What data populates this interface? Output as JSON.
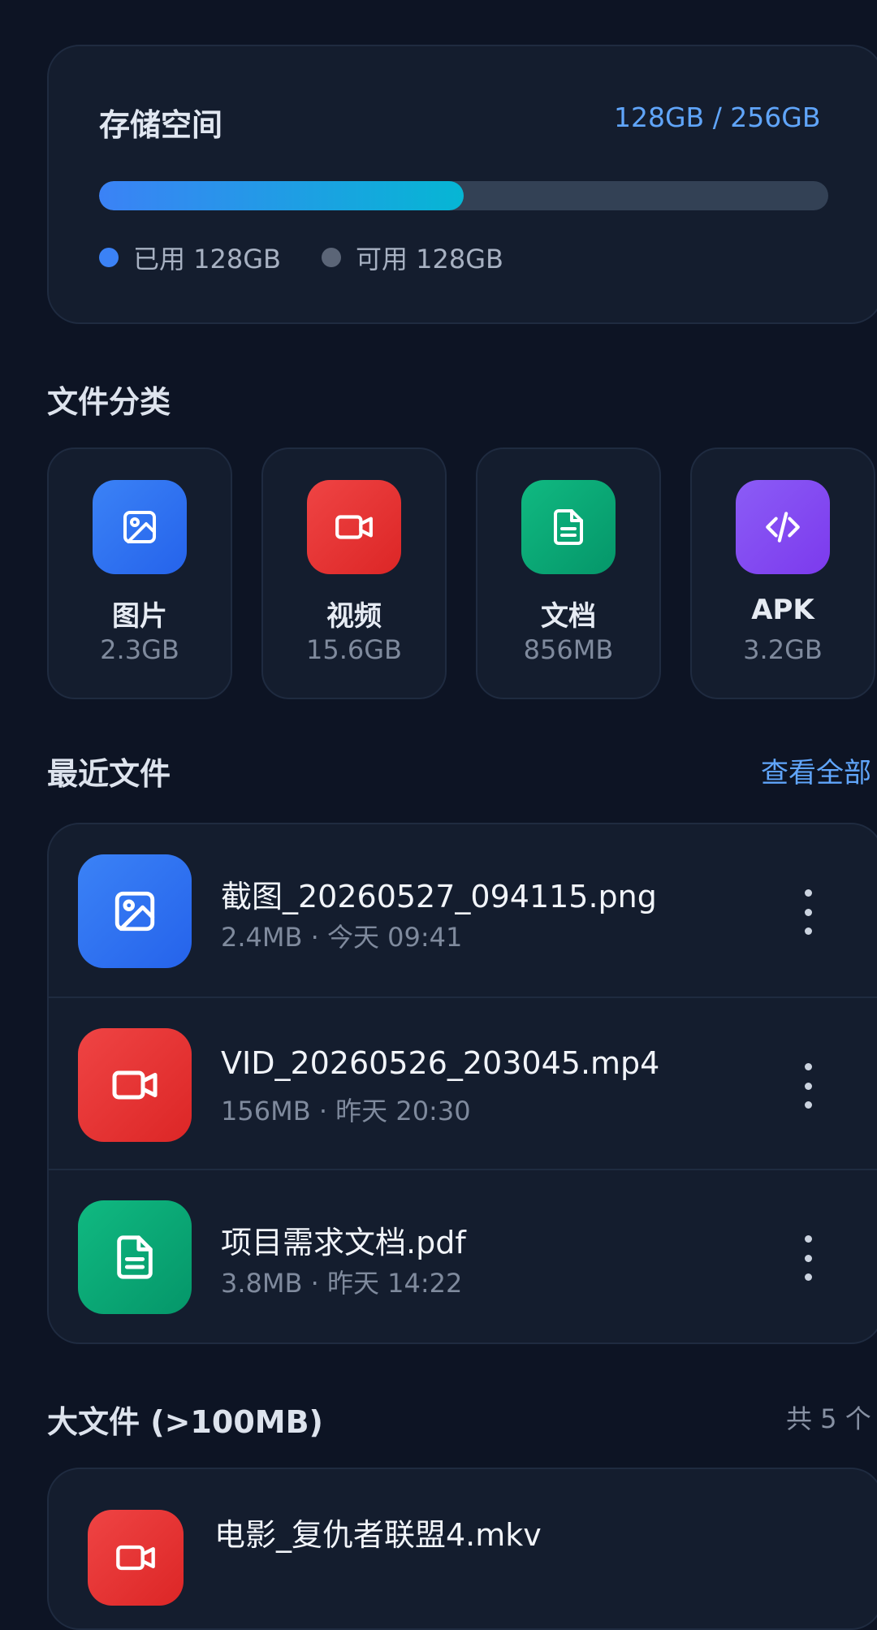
{
  "storage": {
    "title": "存储空间",
    "usage": "128GB / 256GB",
    "used_fraction": 0.5,
    "legend_used": "已用 128GB",
    "legend_free": "可用 128GB",
    "colors": {
      "fill_start": "#3b82f6",
      "fill_end": "#06b6d4",
      "track": "#334155"
    }
  },
  "categories": {
    "title": "文件分类",
    "items": [
      {
        "name": "图片",
        "size": "2.3GB",
        "icon": "image-icon",
        "color": "#3b82f6"
      },
      {
        "name": "视频",
        "size": "15.6GB",
        "icon": "video-icon",
        "color": "#ef4444"
      },
      {
        "name": "文档",
        "size": "856MB",
        "icon": "document-icon",
        "color": "#10b981"
      },
      {
        "name": "APK",
        "size": "3.2GB",
        "icon": "code-icon",
        "color": "#8b5cf6"
      }
    ]
  },
  "recent": {
    "title": "最近文件",
    "view_all": "查看全部",
    "items": [
      {
        "name": "截图_20260527_094115.png",
        "meta": "2.4MB · 今天 09:41",
        "icon": "image-icon"
      },
      {
        "name": "VID_20260526_203045.mp4",
        "meta": "156MB · 昨天 20:30",
        "icon": "video-icon"
      },
      {
        "name": "项目需求文档.pdf",
        "meta": "3.8MB · 昨天 14:22",
        "icon": "document-icon"
      }
    ]
  },
  "large": {
    "title": "大文件 (>100MB)",
    "count": "共 5 个",
    "items": [
      {
        "name": "电影_复仇者联盟4.mkv",
        "icon": "video-icon"
      }
    ]
  }
}
